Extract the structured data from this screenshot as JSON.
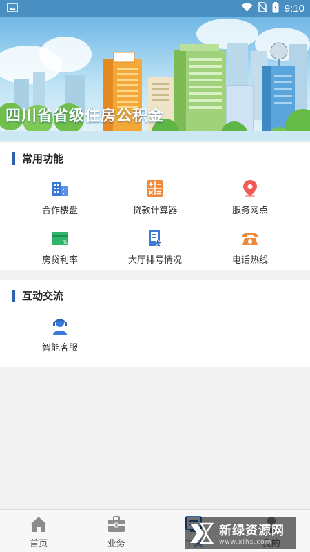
{
  "status_bar": {
    "time": "9:10",
    "icons": [
      "image-icon",
      "wifi-icon",
      "no-sim-icon",
      "battery-icon"
    ]
  },
  "banner": {
    "title": "四川省省级住房公积金"
  },
  "sections": [
    {
      "title": "常用功能",
      "items": [
        {
          "label": "合作楼盘",
          "icon": "building-icon",
          "color": "#3b78d8"
        },
        {
          "label": "贷款计算器",
          "icon": "calculator-icon",
          "color": "#f0883a"
        },
        {
          "label": "服务网点",
          "icon": "location-pin-icon",
          "color": "#f05b57"
        },
        {
          "label": "房贷利率",
          "icon": "rate-card-icon",
          "color": "#2fb46a"
        },
        {
          "label": "大厅排号情况",
          "icon": "queue-ticket-icon",
          "color": "#3b78d8"
        },
        {
          "label": "电话热线",
          "icon": "telephone-icon",
          "color": "#f0883a"
        }
      ]
    },
    {
      "title": "互动交流",
      "items": [
        {
          "label": "智能客服",
          "icon": "customer-service-icon",
          "color": "#3b78d8"
        }
      ]
    }
  ],
  "bottom_nav": [
    {
      "label": "首页",
      "icon": "home-icon",
      "active": false
    },
    {
      "label": "业务",
      "icon": "briefcase-icon",
      "active": false
    },
    {
      "label": "工具",
      "icon": "tools-icon",
      "active": true
    },
    {
      "label": "我的",
      "icon": "user-icon",
      "active": false
    }
  ],
  "watermark": {
    "text": "新绿资源网",
    "url": "www.xlhs.com"
  },
  "colors": {
    "accent": "#2d5fae",
    "status_bar": "#4a8fc1",
    "page_bg": "#f2f2f2",
    "nav_active": "#2d6bb6"
  }
}
